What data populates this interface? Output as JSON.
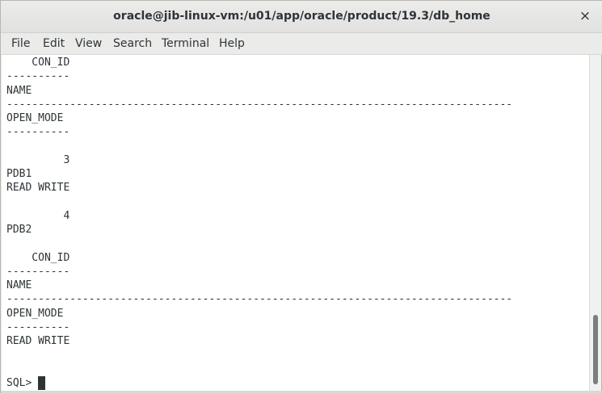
{
  "window": {
    "title": "oracle@jib-linux-vm:/u01/app/oracle/product/19.3/db_home",
    "close_glyph": "×"
  },
  "menu": {
    "items": [
      "File",
      "Edit",
      "View",
      "Search",
      "Terminal",
      "Help"
    ]
  },
  "terminal": {
    "lines": [
      "    CON_ID",
      "----------",
      "NAME",
      "--------------------------------------------------------------------------------",
      "OPEN_MODE",
      "----------",
      "",
      "         3",
      "PDB1",
      "READ WRITE",
      "",
      "         4",
      "PDB2",
      "",
      "    CON_ID",
      "----------",
      "NAME",
      "--------------------------------------------------------------------------------",
      "OPEN_MODE",
      "----------",
      "READ WRITE",
      "",
      "",
      "SQL> "
    ],
    "prompt": "SQL>"
  }
}
